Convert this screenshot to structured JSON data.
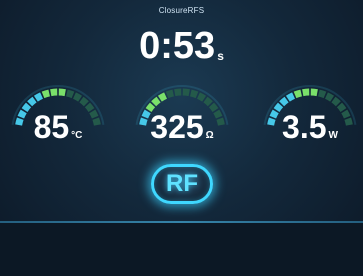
{
  "header": {
    "label": "ClosureRFS"
  },
  "timer": {
    "value": "0:53",
    "unit": "s"
  },
  "metrics": [
    {
      "id": "temperature",
      "value": "85",
      "unit": "°C",
      "level": 0.55
    },
    {
      "id": "impedance",
      "value": "325",
      "unit": "Ω",
      "level": 0.35
    },
    {
      "id": "power",
      "value": "3.5",
      "unit": "W",
      "level": 0.55
    }
  ],
  "rf_button": {
    "label": "RF"
  },
  "colors": {
    "background": "#13283b",
    "accent": "#3fd8ff",
    "gauge_active": "#46c8e8",
    "gauge_highlight": "#7ae06a",
    "gauge_inactive": "#245a4a"
  }
}
